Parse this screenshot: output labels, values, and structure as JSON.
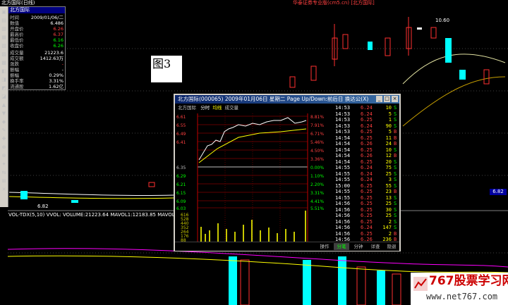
{
  "header": {
    "top_left": "北方国际(日线)",
    "top_center": "华泰证券专业版(cm5.cn) [北方国际]"
  },
  "info_panel": {
    "title": "北方国际",
    "rows": [
      {
        "k": "时间",
        "v": "2009/01/06/二"
      },
      {
        "k": "数值",
        "v": "6.486"
      },
      {
        "k": "开盘价",
        "v": "6.26"
      },
      {
        "k": "最高价",
        "v": "6.37"
      },
      {
        "k": "最低价",
        "v": "6.16"
      },
      {
        "k": "收盘价",
        "v": "6.26"
      },
      {
        "k": "成交量",
        "v": "21223.6"
      },
      {
        "k": "成交额",
        "v": "1412.63万"
      },
      {
        "k": "涨跌",
        "v": "-"
      },
      {
        "k": "振幅",
        "v": "-"
      },
      {
        "k": "振幅",
        "v": "0.29%"
      },
      {
        "k": "换手率",
        "v": "3.31%"
      },
      {
        "k": "流通股",
        "v": "1.62亿"
      }
    ]
  },
  "figure_label": "图3",
  "subchart_info": "VOL-TDX(5,10) VVOL: VOLUME:21223.64 MAVOL1:12183.85 MAVOL2:19830.97",
  "price_markers": {
    "high": "10.60",
    "low": "6.82",
    "badge": "6.82"
  },
  "popup": {
    "title": "北方国际(000065) 2009年01月06日 星期二 Page Up/Down:前后日 换达公(X)",
    "mini_header": [
      "北方国际",
      "分时",
      "均线",
      "成交量"
    ],
    "left_scale": [
      "6.61",
      "6.55",
      "6.49",
      "6.41",
      "6.35",
      "6.29",
      "6.21",
      "6.15",
      "6.09",
      "6.03"
    ],
    "right_scale": [
      "8.81%",
      "7.91%",
      "6.71%",
      "5.46%",
      "4.50%",
      "3.36%",
      "2.24%",
      "1.12%",
      "0.00%",
      "1.10%",
      "2.20%",
      "3.31%",
      "4.41%",
      "5.51%",
      "6.61%"
    ],
    "vol_scale": [
      "616",
      "528",
      "440",
      "352",
      "264",
      "176",
      "88"
    ],
    "tabs": [
      "操作",
      "分笔",
      "分钟",
      "详查",
      "隐退"
    ],
    "ticks": [
      {
        "t": "14:53",
        "p": "6.24",
        "v": "10",
        "d": "S"
      },
      {
        "t": "14:53",
        "p": "6.24",
        "v": "5",
        "d": "S"
      },
      {
        "t": "14:53",
        "p": "6.25",
        "v": "1",
        "d": "S"
      },
      {
        "t": "14:53",
        "p": "6.24",
        "v": "90",
        "d": "S"
      },
      {
        "t": "14:53",
        "p": "6.25",
        "v": "5",
        "d": "B"
      },
      {
        "t": "14:54",
        "p": "6.25",
        "v": "11",
        "d": "B"
      },
      {
        "t": "14:54",
        "p": "6.26",
        "v": "24",
        "d": "B"
      },
      {
        "t": "14:54",
        "p": "6.25",
        "v": "10",
        "d": "S"
      },
      {
        "t": "14:54",
        "p": "6.26",
        "v": "12",
        "d": "B"
      },
      {
        "t": "14:54",
        "p": "6.25",
        "v": "20",
        "d": "S"
      },
      {
        "t": "14:55",
        "p": "6.24",
        "v": "75",
        "d": "S"
      },
      {
        "t": "14:55",
        "p": "6.24",
        "v": "25",
        "d": "S"
      },
      {
        "t": "14:55",
        "p": "6.24",
        "v": "3",
        "d": "S"
      },
      {
        "t": "15:00",
        "p": "6.25",
        "v": "55",
        "d": "S"
      },
      {
        "t": "14:55",
        "p": "6.25",
        "v": "23",
        "d": "B"
      },
      {
        "t": "14:55",
        "p": "6.25",
        "v": "13",
        "d": "S"
      },
      {
        "t": "14:56",
        "p": "6.25",
        "v": "25",
        "d": "S"
      },
      {
        "t": "14:56",
        "p": "6.25",
        "v": "30",
        "d": "S"
      },
      {
        "t": "14:56",
        "p": "6.25",
        "v": "25",
        "d": "S"
      },
      {
        "t": "14:56",
        "p": "6.25",
        "v": "2",
        "d": "S"
      },
      {
        "t": "14:56",
        "p": "6.24",
        "v": "147",
        "d": "S"
      },
      {
        "t": "14:56",
        "p": "6.25",
        "v": "2",
        "d": "B"
      },
      {
        "t": "14:56",
        "p": "6.26",
        "v": "236",
        "d": "B"
      }
    ]
  },
  "watermark": {
    "brand": "767股票学习网",
    "url": "www.net767.com"
  },
  "colors": {
    "up": "#ff3030",
    "down": "#00ffff",
    "vol": "#c8c800",
    "ma1": "#ffffff",
    "ma2": "#ffff00",
    "ma3": "#ff00ff"
  }
}
